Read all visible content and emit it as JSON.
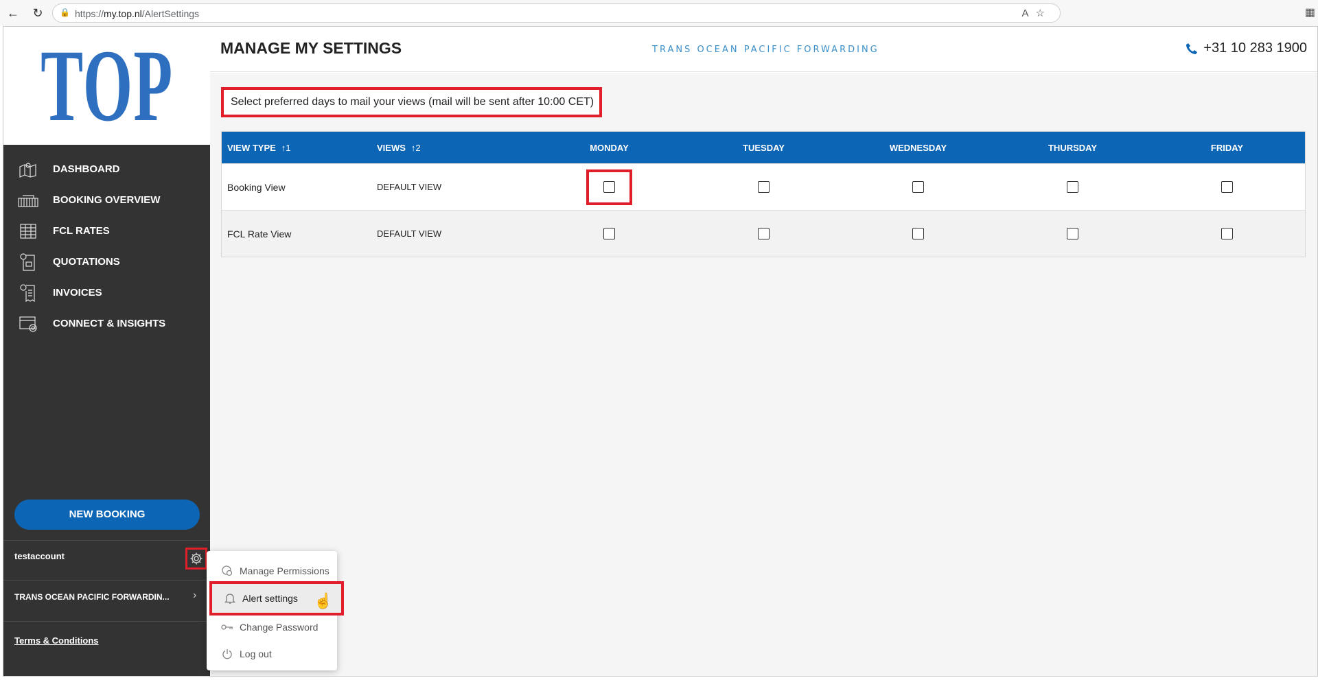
{
  "browser": {
    "url_prefix": "https://",
    "url_host": "my.top.nl",
    "url_path": "/AlertSettings"
  },
  "sidebar": {
    "logo": "TOP",
    "items": [
      {
        "label": "DASHBOARD",
        "icon": "map-icon"
      },
      {
        "label": "BOOKING OVERVIEW",
        "icon": "container-icon"
      },
      {
        "label": "FCL RATES",
        "icon": "rates-table-icon"
      },
      {
        "label": "QUOTATIONS",
        "icon": "quotation-icon"
      },
      {
        "label": "INVOICES",
        "icon": "invoice-icon"
      },
      {
        "label": "CONNECT & INSIGHTS",
        "icon": "connect-icon"
      }
    ],
    "new_booking": "NEW BOOKING",
    "account_name": "testaccount",
    "company_name": "TRANS OCEAN PACIFIC FORWARDIN...",
    "terms": "Terms & Conditions"
  },
  "header": {
    "title": "MANAGE MY SETTINGS",
    "tagline": "TRANS OCEAN PACIFIC FORWARDING",
    "phone": "+31 10 283 1900"
  },
  "notice": "Select preferred days to mail your views (mail will be sent after 10:00 CET)",
  "table": {
    "headers": {
      "view_type": "VIEW TYPE",
      "view_type_sort": "↑1",
      "views": "VIEWS",
      "views_sort": "↑2",
      "days": [
        "MONDAY",
        "TUESDAY",
        "WEDNESDAY",
        "THURSDAY",
        "FRIDAY"
      ]
    },
    "rows": [
      {
        "view_type": "Booking View",
        "view": "DEFAULT VIEW",
        "checked": [
          false,
          false,
          false,
          false,
          false
        ]
      },
      {
        "view_type": "FCL Rate View",
        "view": "DEFAULT VIEW",
        "checked": [
          false,
          false,
          false,
          false,
          false
        ]
      }
    ]
  },
  "dropdown": {
    "items": [
      {
        "label": "Manage Permissions",
        "icon": "permissions-icon"
      },
      {
        "label": "Alert settings",
        "icon": "bell-icon"
      },
      {
        "label": "Change Password",
        "icon": "key-icon"
      },
      {
        "label": "Log out",
        "icon": "power-icon"
      }
    ]
  },
  "colors": {
    "accent": "#0c66b5",
    "sidebar": "#333333",
    "highlight": "#e01f2b"
  }
}
